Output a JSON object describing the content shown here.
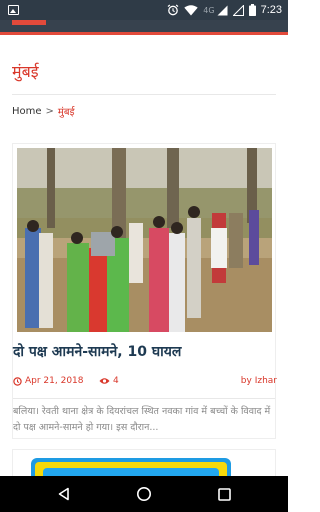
{
  "status_bar": {
    "network": "4G",
    "time": "7:23"
  },
  "page": {
    "title": "मुंबई"
  },
  "breadcrumb": {
    "home": "Home",
    "separator": ">",
    "current": "मुंबई"
  },
  "article": {
    "title": "दो पक्ष आमने-सामने, 10 घायल",
    "date": "Apr 21, 2018",
    "views": "4",
    "author": "by Izhar",
    "excerpt": "बलिया। रेवती थाना क्षेत्र के दियरांचल स्थित नवका गांव में बच्चों के विवाद में दो पक्ष आमने-सामने हो गया। इस दौरान..."
  },
  "icons": {
    "notification": "image-notification-icon",
    "alarm": "alarm-icon",
    "wifi": "wifi-icon",
    "signal": "signal-icon",
    "battery": "battery-icon",
    "date": "clock-icon",
    "views": "eye-icon",
    "back": "back-icon",
    "home": "home-icon",
    "recents": "recents-icon"
  },
  "colors": {
    "accent": "#d9372a",
    "title": "#1e3a52",
    "status_bar": "#2f3b47",
    "app_bar": "#37424e"
  }
}
